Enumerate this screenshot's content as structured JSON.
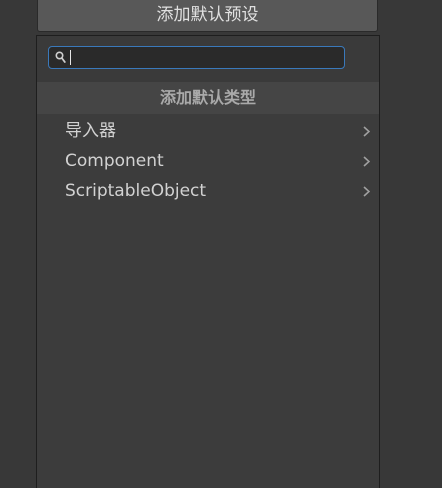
{
  "top_button": {
    "label": "添加默认预设"
  },
  "search": {
    "value": "",
    "placeholder": ""
  },
  "header": {
    "title": "添加默认类型"
  },
  "items": [
    {
      "label": "导入器",
      "icon": "chevron-right-icon"
    },
    {
      "label": "Component",
      "icon": "chevron-right-icon"
    },
    {
      "label": "ScriptableObject",
      "icon": "chevron-right-icon"
    }
  ],
  "colors": {
    "background": "#383838",
    "search_focus_border": "#3a79bb"
  }
}
